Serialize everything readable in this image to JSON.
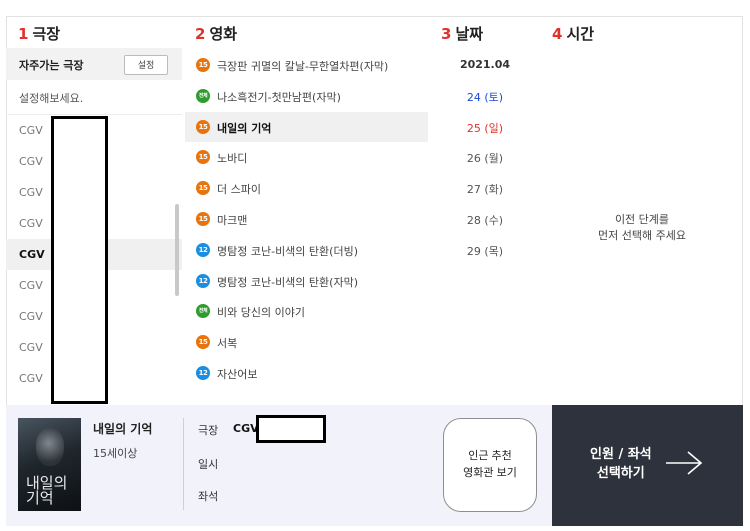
{
  "columns": {
    "theater": {
      "num": "1",
      "label": "극장"
    },
    "movie": {
      "num": "2",
      "label": "영화"
    },
    "date": {
      "num": "3",
      "label": "날짜"
    },
    "time": {
      "num": "4",
      "label": "시간"
    }
  },
  "favorites": {
    "label": "자주가는 극장",
    "button": "설정",
    "hint": "설정해보세요."
  },
  "theaters": [
    {
      "name": "CGV",
      "selected": false
    },
    {
      "name": "CGV",
      "selected": false
    },
    {
      "name": "CGV",
      "selected": false
    },
    {
      "name": "CGV",
      "selected": false
    },
    {
      "name": "CGV",
      "selected": true
    },
    {
      "name": "CGV",
      "selected": false
    },
    {
      "name": "CGV",
      "selected": false
    },
    {
      "name": "CGV",
      "selected": false
    },
    {
      "name": "CGV",
      "selected": false
    }
  ],
  "movies": [
    {
      "age": "15",
      "age_class": "a15",
      "title": "극장판 귀멸의 칼날-무한열차편(자막)",
      "selected": false
    },
    {
      "age": "전체",
      "age_class": "all",
      "title": "나소흑전기-첫만남편(자막)",
      "selected": false
    },
    {
      "age": "15",
      "age_class": "a15",
      "title": "내일의 기억",
      "selected": true
    },
    {
      "age": "15",
      "age_class": "a15",
      "title": "노바디",
      "selected": false
    },
    {
      "age": "15",
      "age_class": "a15",
      "title": "더 스파이",
      "selected": false
    },
    {
      "age": "15",
      "age_class": "a15",
      "title": "마크맨",
      "selected": false
    },
    {
      "age": "12",
      "age_class": "a12",
      "title": "명탐정 코난-비색의 탄환(더빙)",
      "selected": false
    },
    {
      "age": "12",
      "age_class": "a12",
      "title": "명탐정 코난-비색의 탄환(자막)",
      "selected": false
    },
    {
      "age": "전체",
      "age_class": "all",
      "title": "비와 당신의 이야기",
      "selected": false
    },
    {
      "age": "15",
      "age_class": "a15",
      "title": "서복",
      "selected": false
    },
    {
      "age": "12",
      "age_class": "a12",
      "title": "자산어보",
      "selected": false
    }
  ],
  "dates": [
    {
      "text": "2021.04",
      "kind": "month"
    },
    {
      "text": "24 (토)",
      "kind": "sat"
    },
    {
      "text": "25 (일)",
      "kind": "sun"
    },
    {
      "text": "26 (월)",
      "kind": "day"
    },
    {
      "text": "27 (화)",
      "kind": "day"
    },
    {
      "text": "28 (수)",
      "kind": "day"
    },
    {
      "text": "29 (목)",
      "kind": "day"
    }
  ],
  "time_message": {
    "line1": "이전 단계를",
    "line2": "먼저 선택해 주세요"
  },
  "booking": {
    "poster_title": "내일의 기억",
    "movie_title": "내일의 기억",
    "age_text": "15세이상",
    "theater_label": "극장",
    "theater_value": "CGV",
    "datetime_label": "일시",
    "seat_label": "좌석",
    "recommend_line1": "인근 추천",
    "recommend_line2": "영화관 보기",
    "next_line1": "인원 / 좌석",
    "next_line2": "선택하기"
  }
}
